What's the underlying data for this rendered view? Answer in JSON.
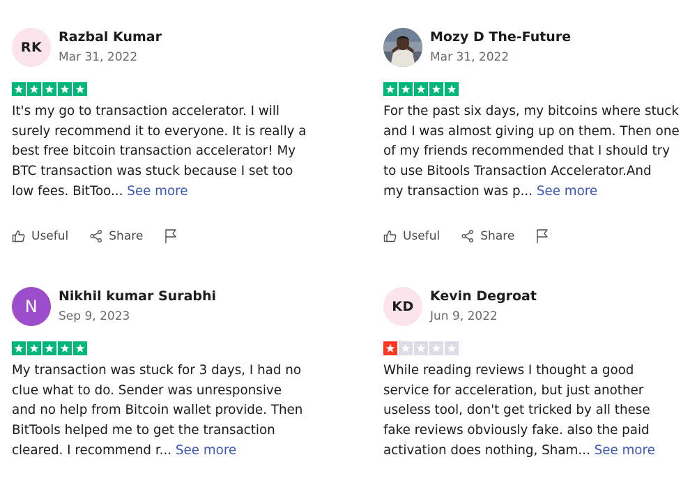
{
  "colors": {
    "star_green": "#00b67a",
    "star_red": "#ff3722",
    "star_empty": "#dcdce6",
    "link_blue": "#3c57bc",
    "rk_avatar_bg": "#fce4ec",
    "n_avatar_bg": "#9c4dcc",
    "kd_avatar_bg": "#fce4ec"
  },
  "actions": {
    "useful_label": "Useful",
    "share_label": "Share",
    "see_more_label": "See more"
  },
  "reviews": [
    {
      "initials": "RK",
      "name": "Razbal Kumar",
      "date": "Mar 31, 2022",
      "rating": 5,
      "lines": [
        "It's my go to transaction accelerator. I will",
        "surely recommend it to everyone. It is really a",
        "best free bitcoin transaction accelerator! My",
        "BTC transaction was stuck because I set too",
        "low fees. BitToo... "
      ]
    },
    {
      "initials": "",
      "name": "Mozy D The-Future",
      "date": "Mar 31, 2022",
      "rating": 5,
      "lines": [
        "For the past six days, my bitcoins where stuck",
        "and I was almost giving up on them. Then one",
        "of my friends recommended that I should try",
        "to use Bitools Transaction Accelerator.And",
        "my transaction was p... "
      ]
    },
    {
      "initials": "N",
      "name": "Nikhil kumar Surabhi",
      "date": "Sep 9, 2023",
      "rating": 5,
      "lines": [
        "My transaction was stuck for 3 days, I had no",
        "clue what to do. Sender was unresponsive",
        "and no help from Bitcoin wallet provide. Then",
        "BitTools helped me to get the transaction",
        "cleared. I recommend r... "
      ]
    },
    {
      "initials": "KD",
      "name": "Kevin Degroat",
      "date": "Jun 9, 2022",
      "rating": 1,
      "lines": [
        "While reading reviews I thought a good",
        "service for acceleration, but just another",
        "useless tool, don't get tricked by all these",
        "fake reviews obviously fake. also the paid",
        "activation does nothing, Sham... "
      ]
    }
  ]
}
